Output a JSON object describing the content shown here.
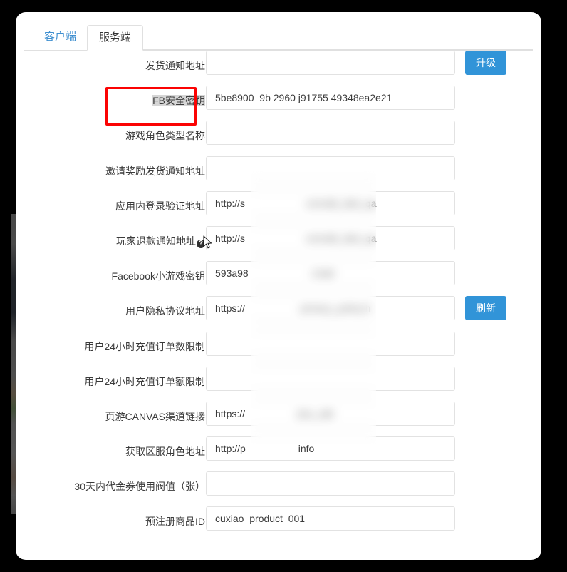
{
  "tabs": [
    {
      "label": "客户端",
      "active": false
    },
    {
      "label": "服务端",
      "active": true
    }
  ],
  "colors": {
    "primary_button": "#3194d8",
    "annotation_box": "#fb0303",
    "tab_link": "#3f8fd0",
    "field_border": "#e2e2e2"
  },
  "form": {
    "rows": [
      {
        "label": "发货通知地址",
        "value": "",
        "placeholder": "",
        "button": "升级",
        "help": false
      },
      {
        "label": "FB安全密钥",
        "value": "5be8900  9b 2960 j91755 49348ea2e21",
        "placeholder": "",
        "button": "",
        "help": false,
        "highlighted_label": true
      },
      {
        "label": "游戏角色类型名称",
        "value": "",
        "placeholder": "",
        "button": "",
        "help": false
      },
      {
        "label": "邀请奖励发货通知地址",
        "value": "",
        "placeholder": "",
        "button": "",
        "help": false
      },
      {
        "label": "应用内登录验证地址",
        "value": "http://s                      om/sdk_bkd_qa",
        "placeholder": "",
        "button": "",
        "help": false
      },
      {
        "label": "玩家退款通知地址",
        "value": "http://s                      om/sdk_bkd_qa",
        "placeholder": "",
        "button": "",
        "help": true
      },
      {
        "label": "Facebook小游戏密钥",
        "value": "593a98                      :14a6",
        "placeholder": "",
        "button": "",
        "help": false
      },
      {
        "label": "用户隐私协议地址",
        "value": "https://                    privacy_policy.h",
        "placeholder": "",
        "button": "刷新",
        "help": false
      },
      {
        "label": "用户24小时充值订单数限制",
        "value": "",
        "placeholder": "",
        "button": "",
        "help": false
      },
      {
        "label": "用户24小时充值订单额限制",
        "value": "",
        "placeholder": "",
        "button": "",
        "help": false
      },
      {
        "label": "页游CANVAS渠道链接",
        "value": "https://                   jhw_sdk",
        "placeholder": "",
        "button": "",
        "help": false
      },
      {
        "label": "获取区服角色地址",
        "value": "http://p                   info",
        "placeholder": "",
        "button": "",
        "help": false
      },
      {
        "label": "30天内代金券使用阀值（张）",
        "value": "",
        "placeholder": "",
        "button": "",
        "help": false
      },
      {
        "label": "预注册商品ID",
        "value": "cuxiao_product_001",
        "placeholder": "",
        "button": "",
        "help": false
      }
    ]
  },
  "annotations": {
    "red_box_target": "FB安全密钥",
    "help_glyph": "?"
  }
}
